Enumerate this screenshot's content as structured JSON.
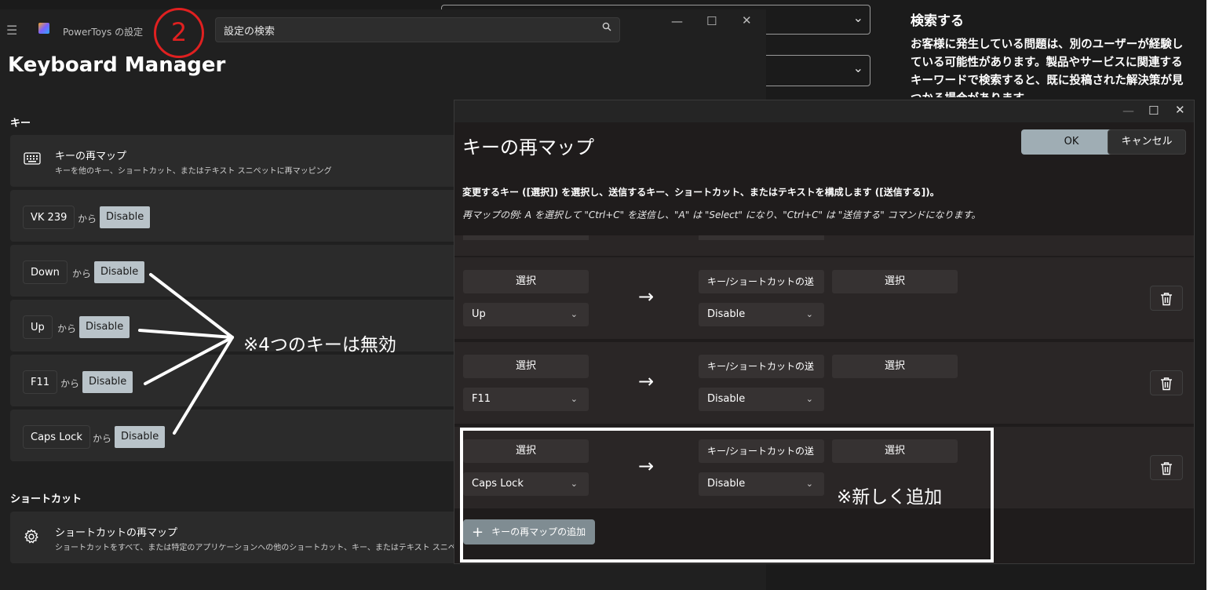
{
  "feedback": {
    "heading": "検索する",
    "text": "お客様に発生している問題は、別のユーザーが経験している可能性があります。製品やサービスに関連するキーワードで検索すると、既に投稿された解決策が見つかる場合があります。"
  },
  "settings": {
    "window_title": "PowerToys の設定",
    "search_placeholder": "設定の検索",
    "page_title": "Keyboard Manager",
    "keys_section": "キー",
    "remap_keys_card": {
      "title": "キーの再マップ",
      "subtitle": "キーを他のキー、ショートカット、またはテキスト スニペットに再マッピング"
    },
    "mappings": [
      {
        "from": "VK 239",
        "joiner": "から",
        "to": "Disable"
      },
      {
        "from": "Down",
        "joiner": "から",
        "to": "Disable"
      },
      {
        "from": "Up",
        "joiner": "から",
        "to": "Disable"
      },
      {
        "from": "F11",
        "joiner": "から",
        "to": "Disable"
      },
      {
        "from": "Caps Lock",
        "joiner": "から",
        "to": "Disable"
      }
    ],
    "shortcuts_section": "ショートカット",
    "remap_shortcuts_card": {
      "title": "ショートカットの再マップ",
      "subtitle": "ショートカットをすべて、または特定のアプリケーションへの他のショートカット、キー、またはテキスト スニペットに再マ"
    }
  },
  "dialog": {
    "title": "キーの再マップ",
    "ok": "OK",
    "cancel": "キャンセル",
    "instruction": "変更するキー ([選択]) を選択し、送信するキー、ショートカット、またはテキストを構成します ([送信する])。",
    "example": "再マップの例: A を選択して \"Ctrl+C\" を送信し、\"A\" は \"Select\" になり、\"Ctrl+C\" は \"送信する\" コマンドになります。",
    "select_label": "選択",
    "type_label": "キー/ショートカットの送",
    "rows": [
      {
        "from_key": "Up",
        "to_key": "Disable"
      },
      {
        "from_key": "F11",
        "to_key": "Disable"
      },
      {
        "from_key": "Caps Lock",
        "to_key": "Disable"
      }
    ],
    "add_button": "キーの再マップの追加"
  },
  "annotations": {
    "step_number": "2",
    "disabled_note": "※4つのキーは無効",
    "new_note": "※新しく追加"
  },
  "icons": {
    "menu": "hamburger-icon",
    "search": "search-icon",
    "keyboard": "keyboard-icon",
    "gear": "gear-icon",
    "trash": "trash-icon",
    "arrow": "right-arrow-icon",
    "plus": "plus-icon",
    "chevron": "chevron-down-icon"
  },
  "colors": {
    "background": "#1b1b1b",
    "disable_chip": "#b9c3c9",
    "ok_button": "#9fadb4",
    "annotation_red": "#e02020"
  }
}
